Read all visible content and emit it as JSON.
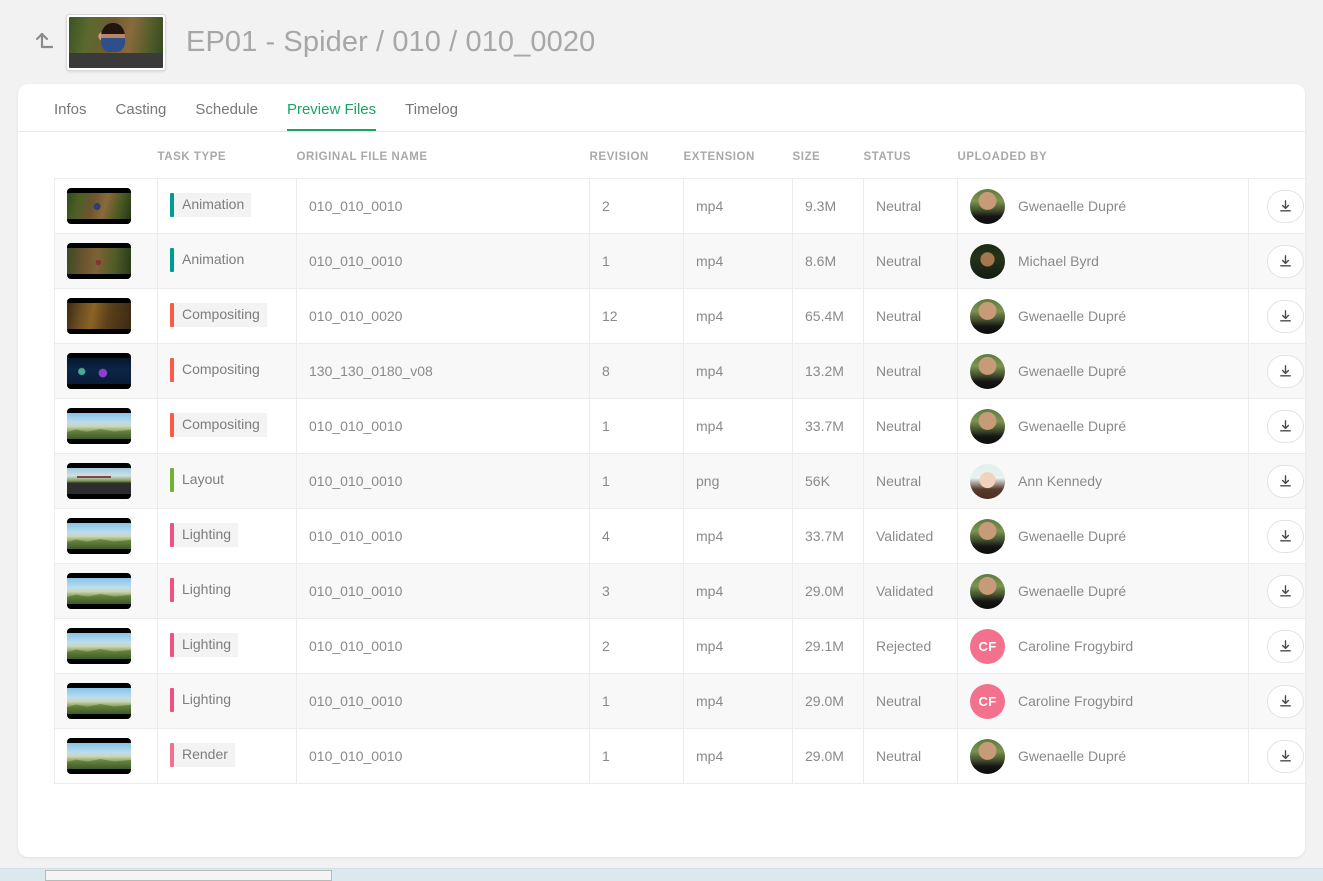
{
  "header": {
    "back_icon": "arrow-up-left-icon",
    "thumbnail_alt": "episode-preview-thumbnail",
    "title": "EP01 - Spider / 010 / 010_0020"
  },
  "tabs": [
    {
      "label": "Infos",
      "active": false
    },
    {
      "label": "Casting",
      "active": false
    },
    {
      "label": "Schedule",
      "active": false
    },
    {
      "label": "Preview Files",
      "active": true
    },
    {
      "label": "Timelog",
      "active": false
    }
  ],
  "accent_color": "#19a463",
  "table": {
    "columns": [
      {
        "key": "thumbnail",
        "label": ""
      },
      {
        "key": "task_type",
        "label": "TASK TYPE"
      },
      {
        "key": "original_file_name",
        "label": "ORIGINAL FILE NAME"
      },
      {
        "key": "revision",
        "label": "REVISION"
      },
      {
        "key": "extension",
        "label": "EXTENSION"
      },
      {
        "key": "size",
        "label": "SIZE"
      },
      {
        "key": "status",
        "label": "STATUS"
      },
      {
        "key": "uploaded_by",
        "label": "UPLOADED BY"
      },
      {
        "key": "download",
        "label": ""
      }
    ],
    "task_type_colors": {
      "Animation": "#009b91",
      "Compositing": "#fc5a4a",
      "Layout": "#70b33b",
      "Lighting": "#f0527f",
      "Render": "#f4718e"
    },
    "rows": [
      {
        "thumbnail": "sc-forest",
        "task_type": "Animation",
        "original_file_name": "010_010_0010",
        "revision": "2",
        "extension": "mp4",
        "size": "9.3M",
        "status": "Neutral",
        "uploaded_by": "Gwenaelle Dupré",
        "avatar_kind": "photo-gwen",
        "avatar_initials": "",
        "download_label": "download-icon"
      },
      {
        "thumbnail": "sc-forest2",
        "task_type": "Animation",
        "original_file_name": "010_010_0010",
        "revision": "1",
        "extension": "mp4",
        "size": "8.6M",
        "status": "Neutral",
        "uploaded_by": "Michael Byrd",
        "avatar_kind": "photo-michael",
        "avatar_initials": "",
        "download_label": "download-icon"
      },
      {
        "thumbnail": "sc-tunnel",
        "task_type": "Compositing",
        "original_file_name": "010_010_0020",
        "revision": "12",
        "extension": "mp4",
        "size": "65.4M",
        "status": "Neutral",
        "uploaded_by": "Gwenaelle Dupré",
        "avatar_kind": "photo-gwen",
        "avatar_initials": "",
        "download_label": "download-icon"
      },
      {
        "thumbnail": "sc-night",
        "task_type": "Compositing",
        "original_file_name": "130_130_0180_v08",
        "revision": "8",
        "extension": "mp4",
        "size": "13.2M",
        "status": "Neutral",
        "uploaded_by": "Gwenaelle Dupré",
        "avatar_kind": "photo-gwen",
        "avatar_initials": "",
        "download_label": "download-icon"
      },
      {
        "thumbnail": "sc-landscape",
        "task_type": "Compositing",
        "original_file_name": "010_010_0010",
        "revision": "1",
        "extension": "mp4",
        "size": "33.7M",
        "status": "Neutral",
        "uploaded_by": "Gwenaelle Dupré",
        "avatar_kind": "photo-gwen",
        "avatar_initials": "",
        "download_label": "download-icon"
      },
      {
        "thumbnail": "sc-plate",
        "task_type": "Layout",
        "original_file_name": "010_010_0010",
        "revision": "1",
        "extension": "png",
        "size": "56K",
        "status": "Neutral",
        "uploaded_by": "Ann Kennedy",
        "avatar_kind": "photo-ann",
        "avatar_initials": "",
        "download_label": "download-icon"
      },
      {
        "thumbnail": "sc-landscape",
        "task_type": "Lighting",
        "original_file_name": "010_010_0010",
        "revision": "4",
        "extension": "mp4",
        "size": "33.7M",
        "status": "Validated",
        "uploaded_by": "Gwenaelle Dupré",
        "avatar_kind": "photo-gwen",
        "avatar_initials": "",
        "download_label": "download-icon"
      },
      {
        "thumbnail": "sc-landscape",
        "task_type": "Lighting",
        "original_file_name": "010_010_0010",
        "revision": "3",
        "extension": "mp4",
        "size": "29.0M",
        "status": "Validated",
        "uploaded_by": "Gwenaelle Dupré",
        "avatar_kind": "photo-gwen",
        "avatar_initials": "",
        "download_label": "download-icon"
      },
      {
        "thumbnail": "sc-landscape",
        "task_type": "Lighting",
        "original_file_name": "010_010_0010",
        "revision": "2",
        "extension": "mp4",
        "size": "29.1M",
        "status": "Rejected",
        "uploaded_by": "Caroline Frogybird",
        "avatar_kind": "initials-cf",
        "avatar_initials": "CF",
        "download_label": "download-icon"
      },
      {
        "thumbnail": "sc-landscape",
        "task_type": "Lighting",
        "original_file_name": "010_010_0010",
        "revision": "1",
        "extension": "mp4",
        "size": "29.0M",
        "status": "Neutral",
        "uploaded_by": "Caroline Frogybird",
        "avatar_kind": "initials-cf",
        "avatar_initials": "CF",
        "download_label": "download-icon"
      },
      {
        "thumbnail": "sc-landscape",
        "task_type": "Render",
        "original_file_name": "010_010_0010",
        "revision": "1",
        "extension": "mp4",
        "size": "29.0M",
        "status": "Neutral",
        "uploaded_by": "Gwenaelle Dupré",
        "avatar_kind": "photo-gwen",
        "avatar_initials": "",
        "download_label": "download-icon"
      }
    ]
  },
  "scrollbar": {
    "orientation": "horizontal"
  }
}
